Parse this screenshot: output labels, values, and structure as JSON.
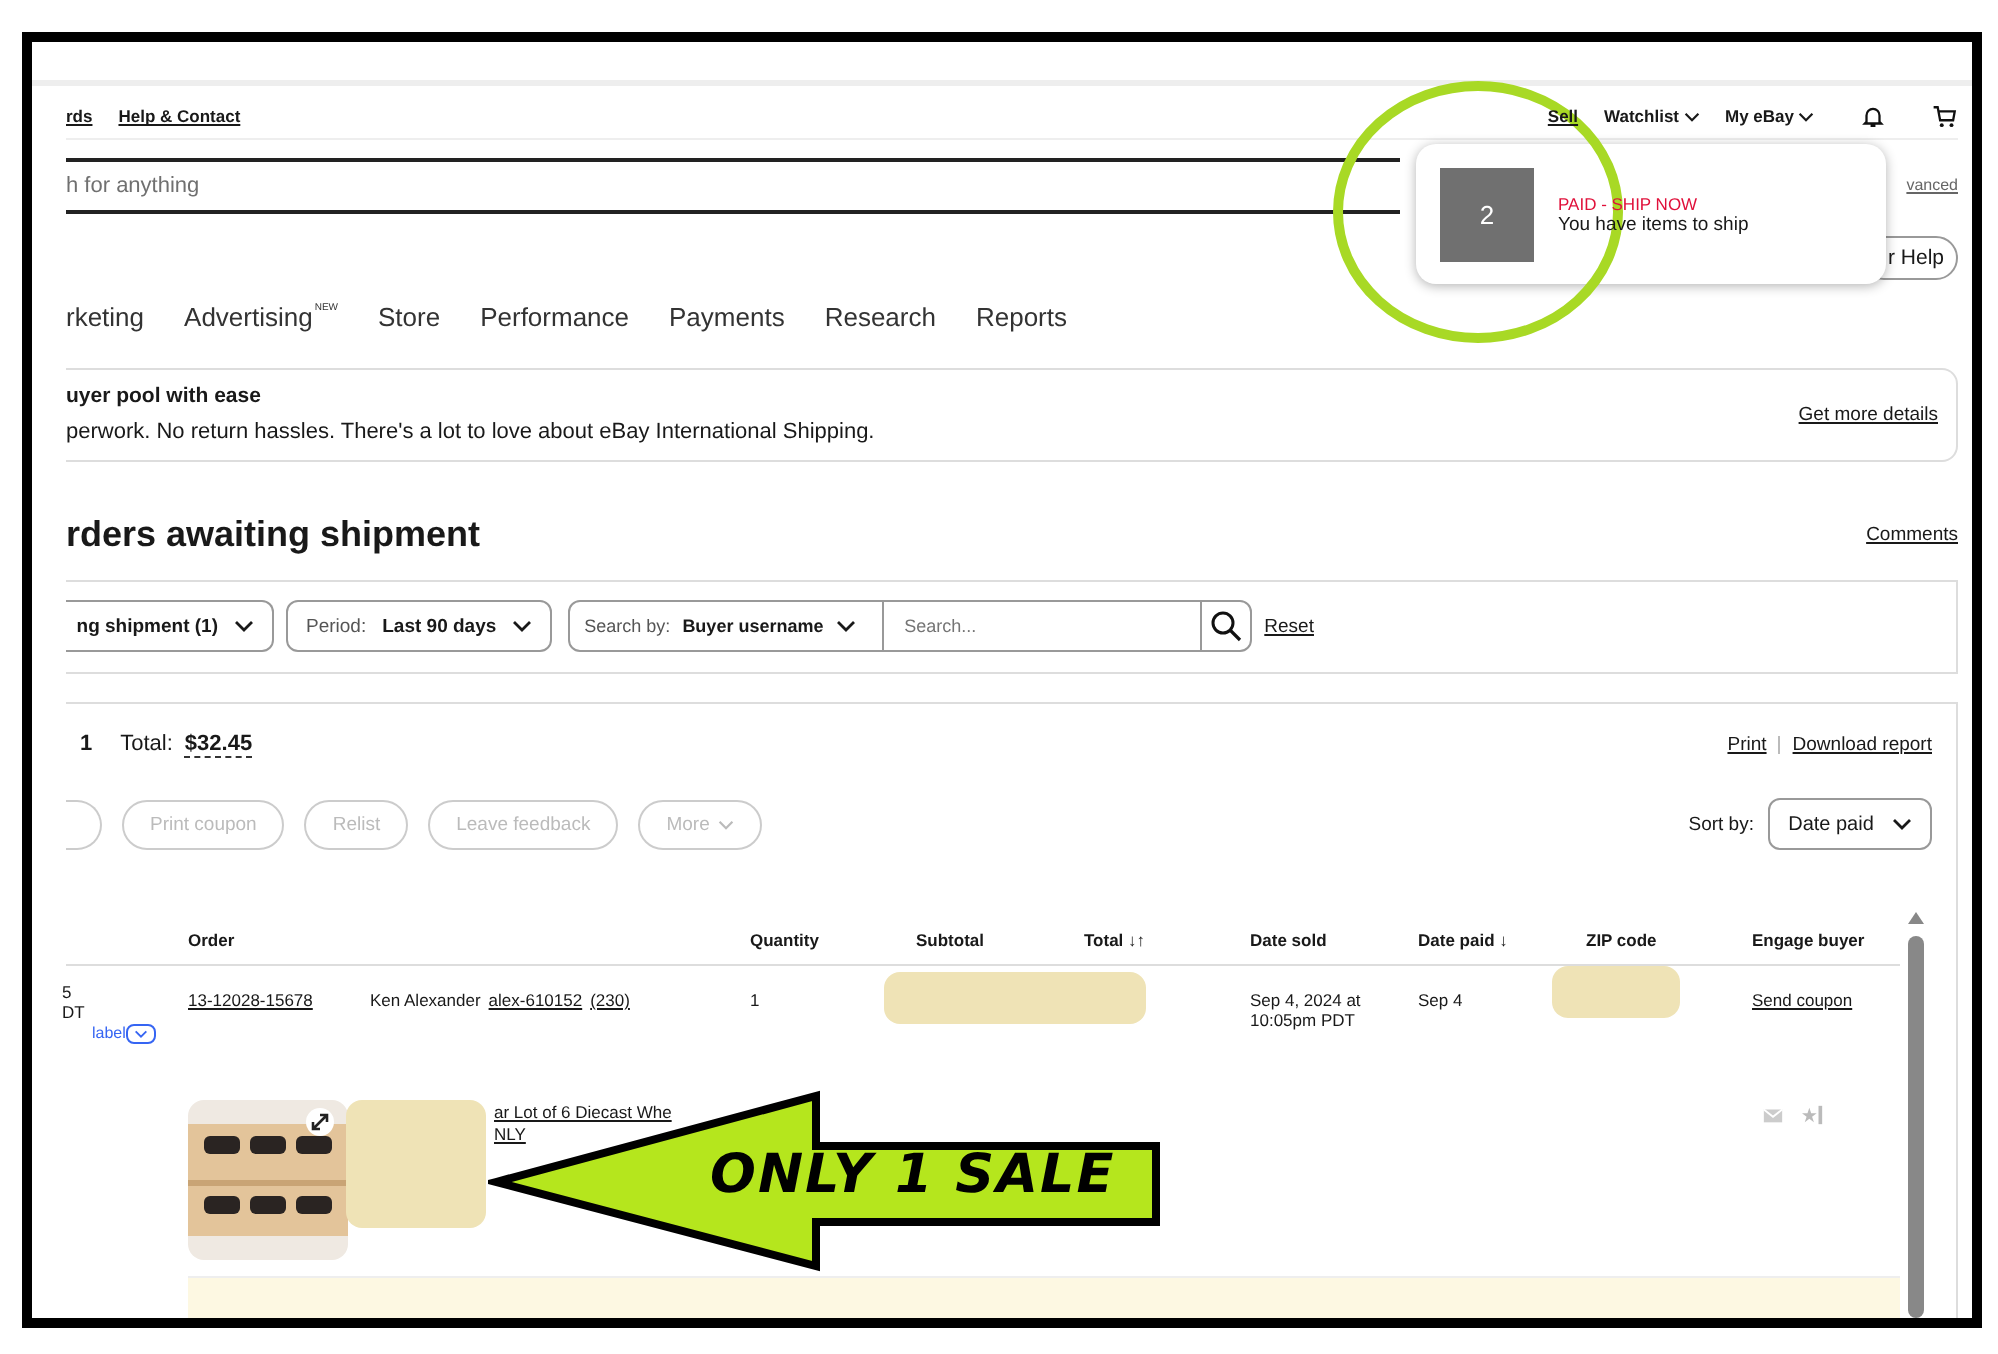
{
  "top_nav": {
    "left_links": [
      "rds",
      "Help & Contact"
    ],
    "right_links": [
      {
        "label": "Sell",
        "dropdown": false
      },
      {
        "label": "Watchlist",
        "dropdown": true
      },
      {
        "label": "My eBay",
        "dropdown": true
      }
    ]
  },
  "search": {
    "placeholder": "h for anything",
    "advanced_link": "vanced"
  },
  "notification": {
    "count": "2",
    "status": "PAID - SHIP NOW",
    "message": "You have items to ship"
  },
  "help_button": "r Help",
  "tabs": [
    {
      "label": "rketing"
    },
    {
      "label": "Advertising",
      "badge": "NEW"
    },
    {
      "label": "Store"
    },
    {
      "label": "Performance"
    },
    {
      "label": "Payments"
    },
    {
      "label": "Research"
    },
    {
      "label": "Reports"
    }
  ],
  "banner": {
    "title": "uyer pool with ease",
    "text": "perwork. No return hassles. There's a lot to love about eBay International Shipping.",
    "link": "Get more details"
  },
  "heading": "rders awaiting shipment",
  "comments_link": "Comments",
  "filters": [
    {
      "value": "ng shipment (1)"
    },
    {
      "prefix": "Period:",
      "value": "Last 90 days"
    }
  ],
  "search_by": {
    "prefix": "Search by:",
    "value": "Buyer username",
    "placeholder": "Search..."
  },
  "reset_link": "Reset",
  "results": {
    "count": "1",
    "total_label": "Total:",
    "total": "$32.45",
    "links": [
      "Print",
      "Download report"
    ]
  },
  "actions": [
    {
      "label": "Print coupon",
      "disabled": true,
      "dropdown": false
    },
    {
      "label": "Relist",
      "disabled": true,
      "dropdown": false
    },
    {
      "label": "Leave feedback",
      "disabled": true,
      "dropdown": false
    },
    {
      "label": "More",
      "disabled": true,
      "dropdown": true
    }
  ],
  "sort": {
    "label": "Sort by:",
    "value": "Date paid"
  },
  "table": {
    "columns": [
      {
        "label": "Order"
      },
      {
        "label": "Quantity"
      },
      {
        "label": "Subtotal"
      },
      {
        "label": "Total",
        "sort_mark": "↓↑"
      },
      {
        "label": "Date sold"
      },
      {
        "label": "Date paid",
        "sort_mark": "↓"
      },
      {
        "label": "ZIP code"
      },
      {
        "label": "Engage buyer"
      }
    ],
    "rows": [
      {
        "column_1": [
          "5",
          "DT"
        ],
        "label_link": "label",
        "order": "13-12028-15678",
        "buyer_name": "Ken Alexander",
        "buyer_id": "alex-610152",
        "feedback": "(230)",
        "quantity": "1",
        "date_sold": "Sep 4, 2024 at 10:05pm PDT",
        "date_paid": "Sep 4",
        "engage": "Send coupon",
        "item": {
          "title": "ar Lot of 6 Diecast Whe",
          "note": "NLY"
        }
      }
    ]
  },
  "annotation": {
    "text": "ONLY 1 SALE"
  }
}
